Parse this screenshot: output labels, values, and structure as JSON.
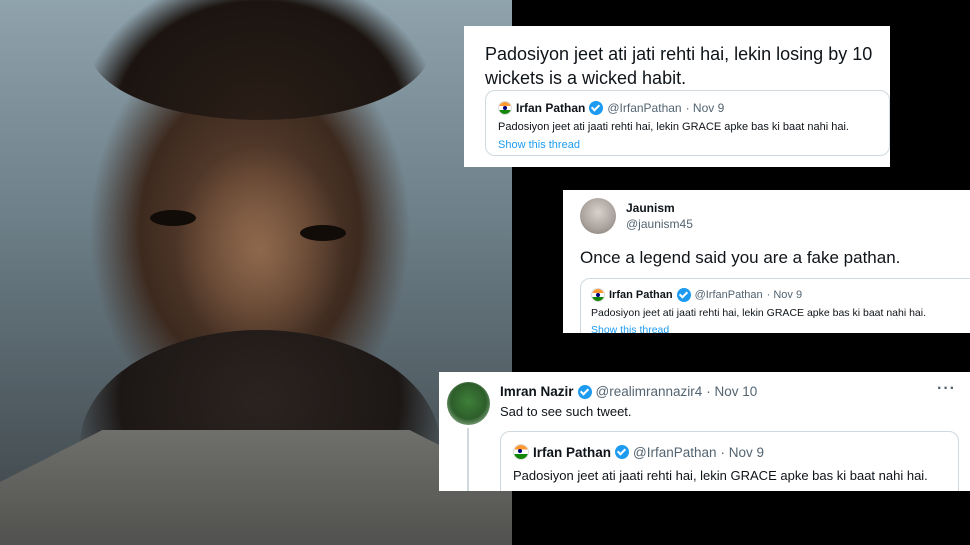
{
  "tweet1": {
    "text": "Padosiyon jeet ati jati rehti hai, lekin losing by 10 wickets is a wicked habit.",
    "quote": {
      "name": "Irfan Pathan",
      "handle": "@IrfanPathan",
      "date": "· Nov 9",
      "text": "Padosiyon jeet ati jaati rehti hai, lekin GRACE apke bas ki baat nahi hai.",
      "show_thread": "Show this thread"
    }
  },
  "tweet2": {
    "name": "Jaunism",
    "handle": "@jaunism45",
    "text": "Once a legend said you are a fake pathan.",
    "quote": {
      "name": "Irfan Pathan",
      "handle": "@IrfanPathan",
      "date": "· Nov 9",
      "text": "Padosiyon jeet ati jaati rehti hai, lekin GRACE apke bas ki baat nahi hai.",
      "show_thread": "Show this thread"
    }
  },
  "tweet3": {
    "name": "Imran Nazir",
    "handle": "@realimrannazir4",
    "date": "· Nov 10",
    "more": "···",
    "text": "Sad to see such tweet.",
    "quote": {
      "name": "Irfan Pathan",
      "handle": "@IrfanPathan",
      "date": "· Nov 9",
      "text": "Padosiyon jeet ati jaati rehti hai, lekin GRACE apke bas ki baat nahi hai."
    }
  },
  "colors": {
    "verified": "#1d9bf0",
    "link": "#1d9bf0",
    "muted": "#536471"
  }
}
